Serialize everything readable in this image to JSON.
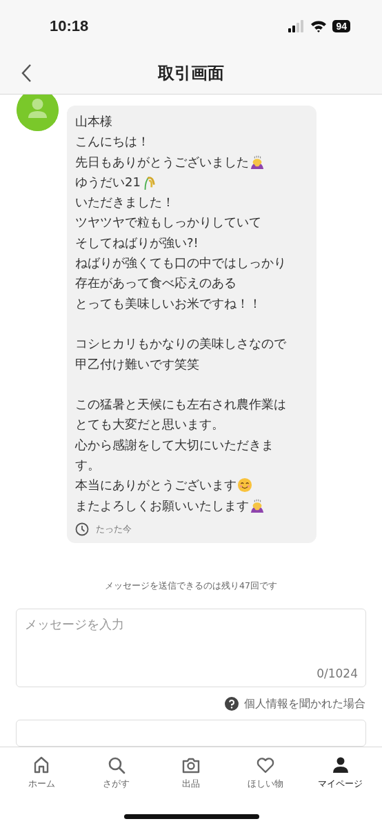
{
  "status_bar": {
    "time": "10:18",
    "battery": "94"
  },
  "header": {
    "title": "取引画面"
  },
  "message": {
    "paragraphs": [
      {
        "lines": [
          {
            "text": "山本様"
          },
          {
            "text": "こんにちは！"
          },
          {
            "text": "先日もありがとうございました",
            "kind": "bow"
          },
          {
            "text": "ゆうだい21",
            "kind": "rice"
          },
          {
            "text": "いただきました！"
          },
          {
            "text": "ツヤツヤで粒もしっかりしていて"
          },
          {
            "text": "そしてねばりが強い?!"
          },
          {
            "text": "ねばりが強くても口の中ではしっかり"
          },
          {
            "text": "存在があって食べ応えのある"
          },
          {
            "text": "とっても美味しいお米ですね！！"
          }
        ]
      },
      {
        "lines": [
          {
            "text": "コシヒカリもかなりの美味しさなので"
          },
          {
            "text": "甲乙付け難いです笑笑"
          }
        ]
      },
      {
        "lines": [
          {
            "text": "この猛暑と天候にも左右され農作業は"
          },
          {
            "text": "とても大変だと思います。"
          },
          {
            "text": "心から感謝をして大切にいただきま"
          },
          {
            "text": "す。"
          },
          {
            "text": "本当にありがとうございます",
            "kind": "smile"
          },
          {
            "text": "またよろしくお願いいたします",
            "kind": "bow"
          }
        ]
      }
    ],
    "time": "たった今"
  },
  "remaining_notice": "メッセージを送信できるのは残り47回です",
  "message_input": {
    "placeholder": "メッセージを入力",
    "counter": "0/1024"
  },
  "help_link": "個人情報を聞かれた場合",
  "tab_bar": [
    {
      "label": "ホーム",
      "selected": false
    },
    {
      "label": "さがす",
      "selected": false
    },
    {
      "label": "出品",
      "selected": false
    },
    {
      "label": "ほしい物",
      "selected": false
    },
    {
      "label": "マイページ",
      "selected": true
    }
  ]
}
